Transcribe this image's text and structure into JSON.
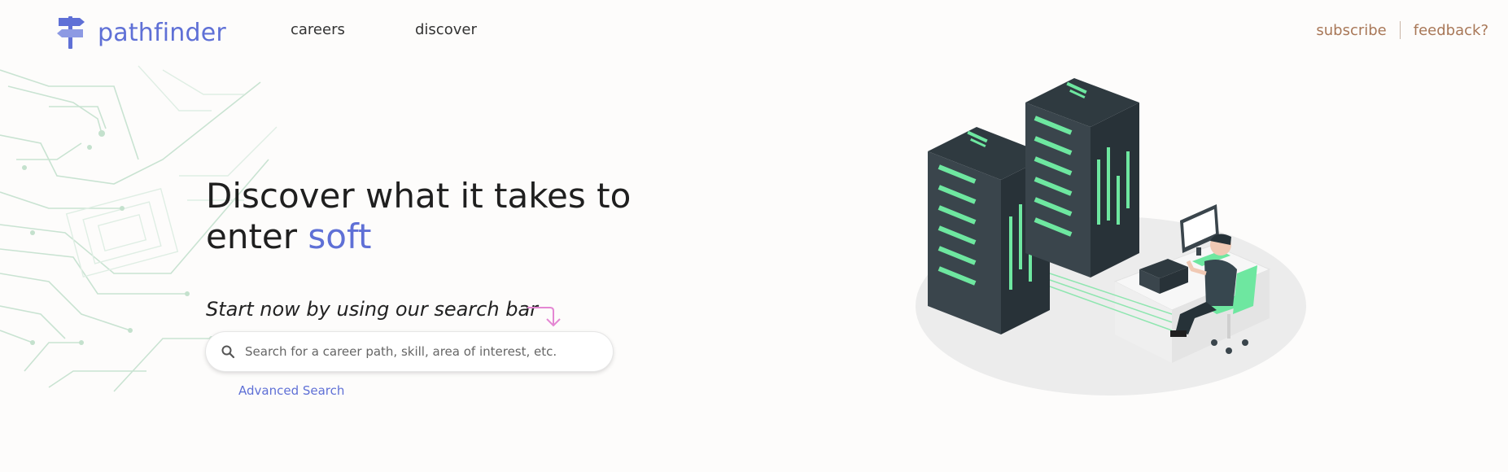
{
  "brand": {
    "name": "pathfinder",
    "color": "#5f70d6",
    "icon": "signpost-icon"
  },
  "nav": {
    "links": [
      "careers",
      "discover"
    ]
  },
  "header_right": {
    "subscribe": "subscribe",
    "feedback": "feedback?"
  },
  "hero": {
    "headline_part1": "Discover what it takes to",
    "headline_part2": "enter",
    "headline_accent": "soft",
    "subtitle": "Start now by using our search bar",
    "arrow_icon": "curved-arrow-icon"
  },
  "search": {
    "placeholder": "Search for a career path, skill, area of interest, etc.",
    "value": "",
    "icon": "search-icon"
  },
  "advanced_search": "Advanced Search",
  "colors": {
    "accent": "#5f70d6",
    "link_brown": "#a87757",
    "server_green": "#6ee7a0",
    "arrow_pink": "#e487d3"
  }
}
